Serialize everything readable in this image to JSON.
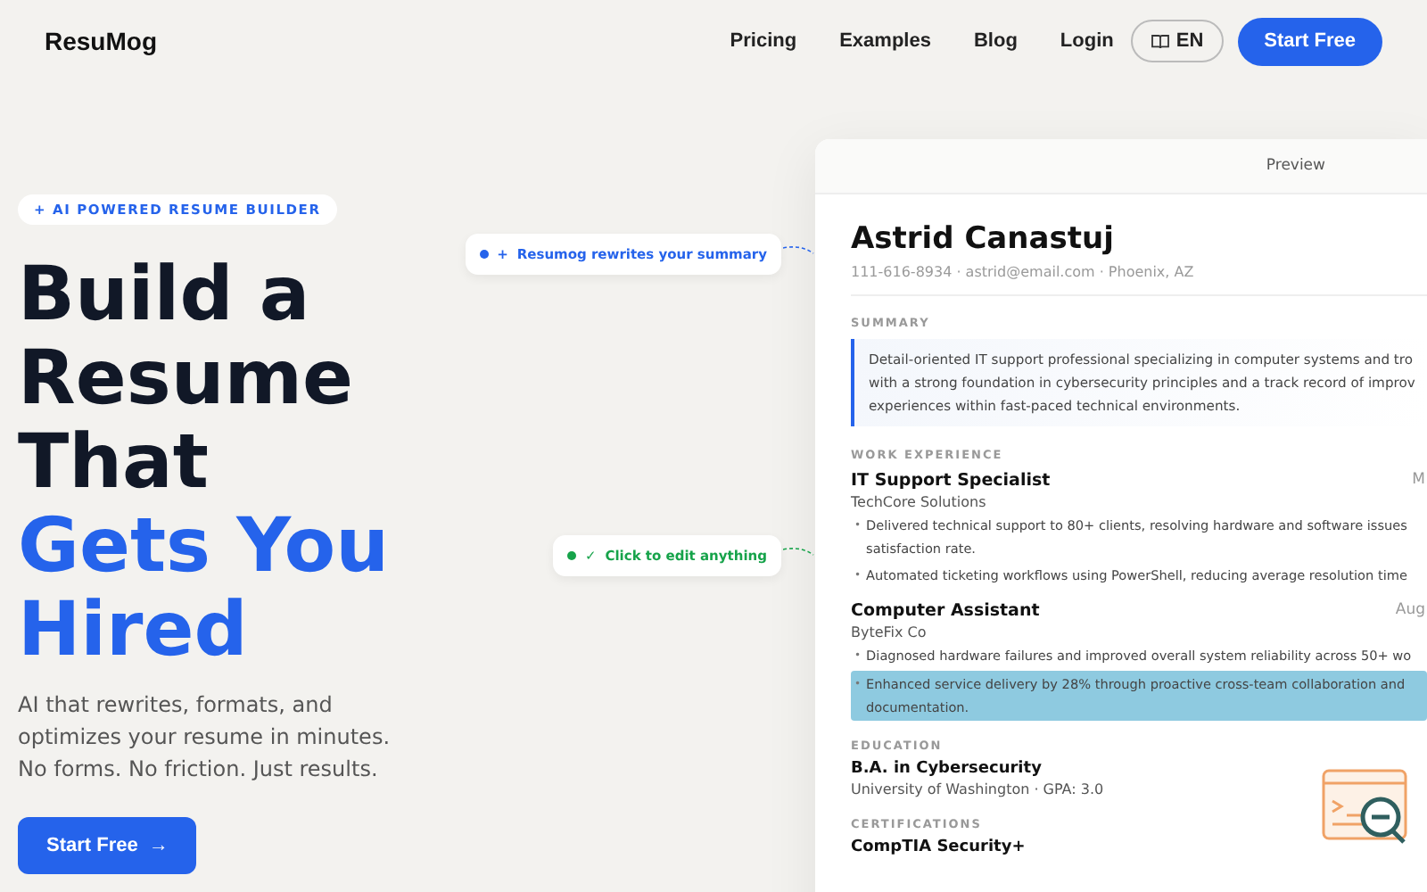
{
  "header": {
    "logo": "ResuMog",
    "nav": [
      "Pricing",
      "Examples",
      "Blog",
      "Login"
    ],
    "language": "EN",
    "cta": "Start Free"
  },
  "hero": {
    "badge": "+ AI POWERED RESUME BUILDER",
    "headline": [
      {
        "text": "Build a",
        "accent": false
      },
      {
        "text": "Resume",
        "accent": false
      },
      {
        "text": "That",
        "accent": false
      },
      {
        "text": "Gets You",
        "accent": true
      },
      {
        "text": "Hired",
        "accent": true
      }
    ],
    "subtitle": "AI that rewrites, formats, and optimizes your resume in minutes. No forms. No friction. Just results.",
    "cta": "Start Free",
    "cta_arrow": "→"
  },
  "callouts": [
    {
      "icon": "+",
      "text": "Resumog rewrites your summary",
      "color": "#2563eb"
    },
    {
      "icon": "✓",
      "text": "Click to edit anything",
      "color": "#16a34a"
    }
  ],
  "preview": {
    "tab": "Preview",
    "name": "Astrid Canastuj",
    "contact": "111-616-8934 · astrid@email.com · Phoenix, AZ",
    "summary_label": "SUMMARY",
    "summary_lines": [
      "Detail-oriented IT support professional specializing in computer systems and tro",
      "with a strong foundation in cybersecurity principles and a track record of improv",
      "experiences within fast-paced technical environments."
    ],
    "experience_label": "WORK EXPERIENCE",
    "jobs": [
      {
        "title": "IT Support Specialist",
        "date": "M",
        "company": "TechCore Solutions",
        "bullets": [
          {
            "marker": "•",
            "lines": [
              "Delivered technical support to 80+ clients, resolving hardware and software issues",
              "satisfaction rate."
            ],
            "highlighted": false
          },
          {
            "marker": "•",
            "lines": [
              "Automated ticketing workflows using PowerShell, reducing average resolution time"
            ],
            "highlighted": false
          }
        ]
      },
      {
        "title": "Computer Assistant",
        "date": "Aug",
        "company": "ByteFix Co",
        "bullets": [
          {
            "marker": "•",
            "lines": [
              "Diagnosed hardware failures and improved overall system reliability across 50+ wo"
            ],
            "highlighted": false
          },
          {
            "marker": "•",
            "lines": [
              "Enhanced service delivery by 28% through proactive cross-team collaboration and",
              "documentation."
            ],
            "highlighted": true
          }
        ]
      }
    ],
    "education_label": "EDUCATION",
    "degree": "B.A. in Cybersecurity",
    "school": "University of Washington · GPA: 3.0",
    "certifications_label": "CERTIFICATIONS",
    "certification": "CompTIA Security+"
  }
}
